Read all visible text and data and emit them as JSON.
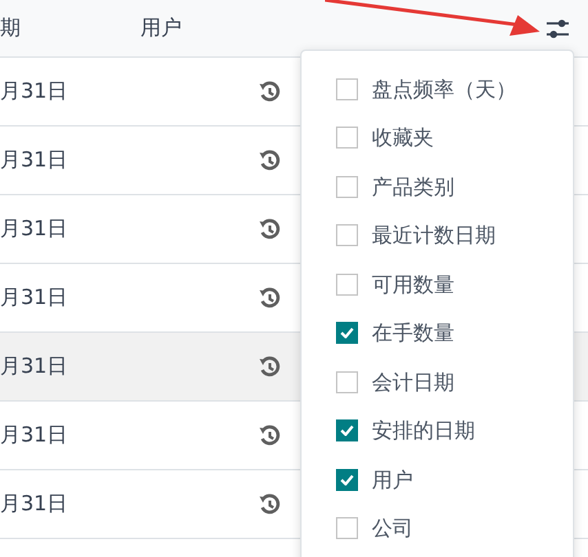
{
  "table": {
    "columns": [
      "期",
      "用户"
    ],
    "rows": [
      {
        "date": "月31日",
        "selected": false
      },
      {
        "date": "月31日",
        "selected": false
      },
      {
        "date": "月31日",
        "selected": false
      },
      {
        "date": "月31日",
        "selected": false
      },
      {
        "date": "月31日",
        "selected": true
      },
      {
        "date": "月31日",
        "selected": false
      },
      {
        "date": "月31日",
        "selected": false
      }
    ]
  },
  "column_menu": {
    "items": [
      {
        "label": "盘点频率（天）",
        "checked": false
      },
      {
        "label": "收藏夹",
        "checked": false
      },
      {
        "label": "产品类别",
        "checked": false
      },
      {
        "label": "最近计数日期",
        "checked": false
      },
      {
        "label": "可用数量",
        "checked": false
      },
      {
        "label": "在手数量",
        "checked": true
      },
      {
        "label": "会计日期",
        "checked": false
      },
      {
        "label": "安排的日期",
        "checked": true
      },
      {
        "label": "用户",
        "checked": true
      },
      {
        "label": "公司",
        "checked": false
      }
    ]
  }
}
